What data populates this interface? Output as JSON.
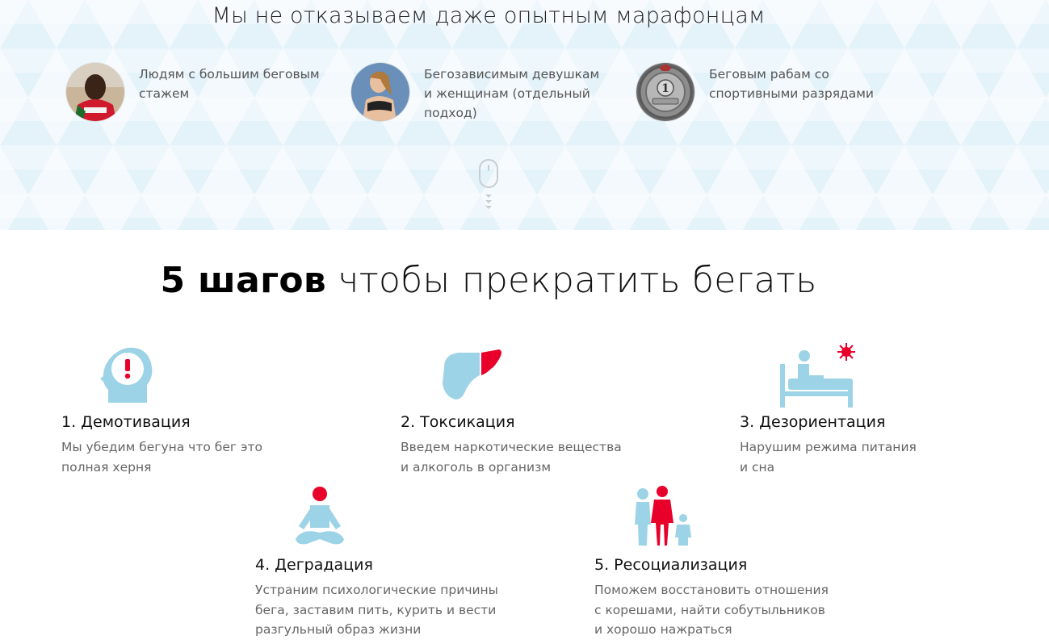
{
  "top": {
    "title": "Мы не отказываем даже опытным марафонцам",
    "audience": [
      {
        "text": "Людям с большим беговым\nстажем",
        "avatar_icon": "runner-man-photo"
      },
      {
        "text": "Бегозависимым девушкам\nи женщинам (отдельный\nподход)",
        "avatar_icon": "runner-woman-photo"
      },
      {
        "text": "Беговым рабам со\nспортивными разрядами",
        "avatar_icon": "first-rank-medal"
      }
    ],
    "scroll_icon": "mouse-scroll-icon"
  },
  "steps": {
    "title_bold": "5 шагов",
    "title_rest": " чтобы прекратить бегать",
    "items": [
      {
        "name": "1. Демотивация",
        "desc": "Мы убедим бегуна что бег это\nполная херня",
        "icon": "head-exclamation-icon"
      },
      {
        "name": "2. Токсикация",
        "desc": "Введем наркотические вещества\nи алкоголь в организм",
        "icon": "liver-icon"
      },
      {
        "name": "3. Дезориентация",
        "desc": "Нарушим режима питания\nи сна",
        "icon": "bed-sun-icon"
      },
      {
        "name": "4. Деградация",
        "desc": "Устраним психологические причины\nбега, заставим пить, курить и вести\nразгульный образ жизни",
        "icon": "meditation-icon"
      },
      {
        "name": "5. Ресоциализация",
        "desc": "Поможем восстановить отношения\nс корешами, найти собутыльников\nи хорошо нажраться",
        "icon": "family-icon"
      }
    ]
  },
  "colors": {
    "icon_blue": "#9dd3e6",
    "accent_red": "#e8002a"
  }
}
